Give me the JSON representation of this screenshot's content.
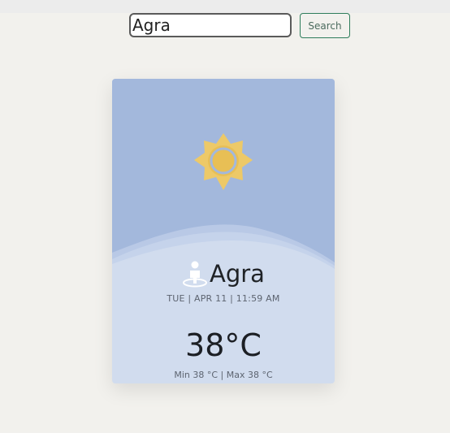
{
  "search": {
    "value": "Agra",
    "button_label": "Search"
  },
  "weather": {
    "icon": "sun-icon",
    "city": "Agra",
    "datetime": "TUE | APR 11 | 11:59 AM",
    "temperature": "38°C",
    "minmax": "Min 38 °C | Max 38 °C"
  },
  "colors": {
    "page_background": "#f2f1ed",
    "card_top": "#a3b8dc",
    "card_bottom": "#d1dcee",
    "sun": "#edc968",
    "button_border": "#2e7d5b"
  }
}
